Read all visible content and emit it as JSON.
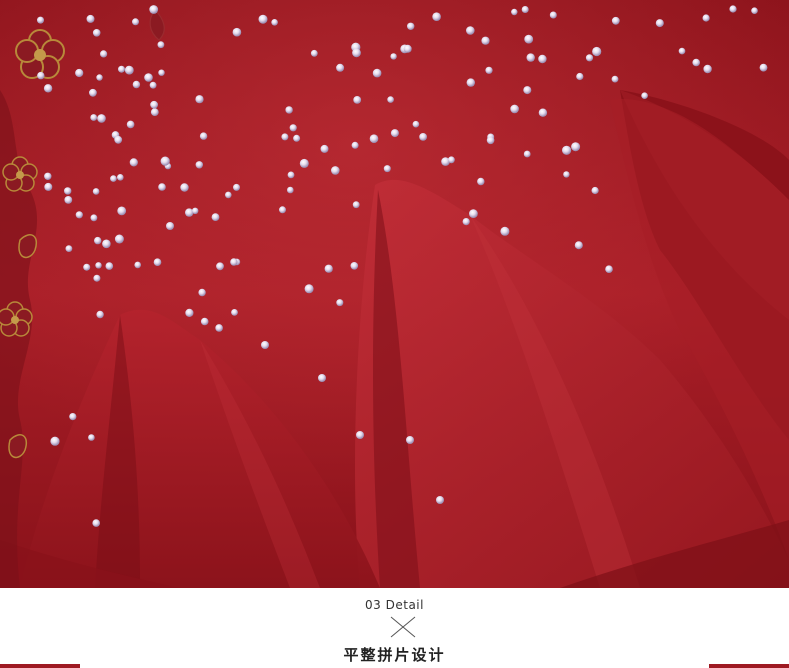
{
  "caption": {
    "detail_label": "03 Detail",
    "subtitle": "平整拼片设计"
  },
  "colors": {
    "fabric_base": "#9e1a22",
    "fabric_dark": "#6e0d14",
    "fabric_light": "#c22a33",
    "tulle": "#b3222c",
    "embroidery_gold": "#b8893a",
    "rhinestone": "#e9e3ef",
    "caption_text": "#222222"
  },
  "icons": {
    "divider": "cross-divider-icon"
  }
}
